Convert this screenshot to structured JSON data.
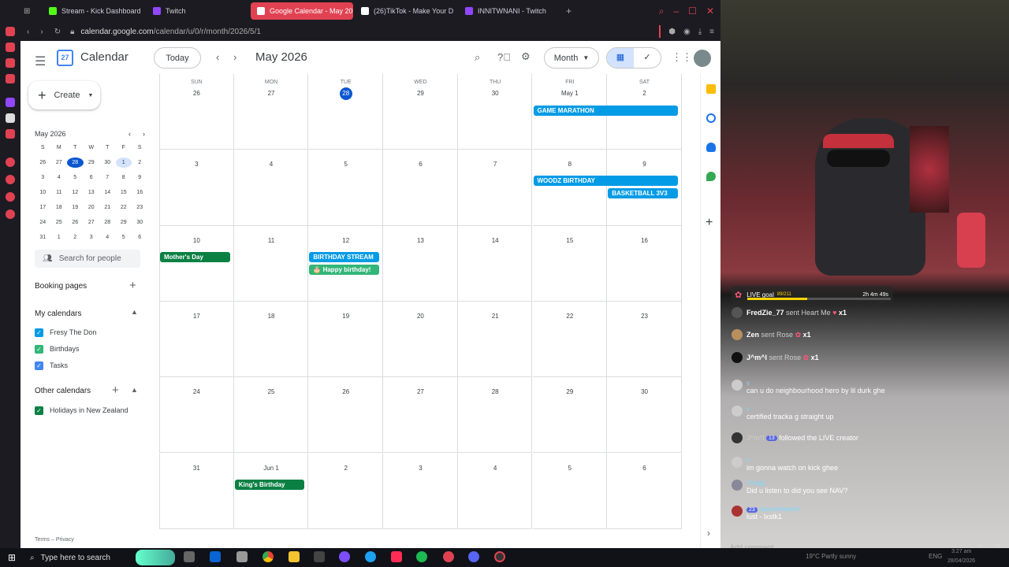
{
  "browser": {
    "tabs": [
      {
        "label": "Stream - Kick Dashboard",
        "color": "#53fc18"
      },
      {
        "label": "Twitch",
        "color": "#9146ff"
      },
      {
        "label": "Google Calendar - May 20",
        "color": "#4285f4"
      },
      {
        "label": "(26)TikTok - Make Your D",
        "color": "#ffffff"
      },
      {
        "label": "INNITWNANI - Twitch",
        "color": "#9146ff"
      }
    ],
    "new_tab": "+",
    "url_domain": "calendar.google.com",
    "url_path": "/calendar/u/0/r/month/2026/5/1"
  },
  "calendar": {
    "app_title": "Calendar",
    "logo_text": "27",
    "today_label": "Today",
    "month_title": "May 2026",
    "view_label": "Month",
    "create_label": "Create",
    "mini": {
      "title": "May 2026",
      "dow": [
        "S",
        "M",
        "T",
        "W",
        "T",
        "F",
        "S"
      ],
      "days": [
        "26",
        "27",
        "28",
        "29",
        "30",
        "1",
        "2",
        "3",
        "4",
        "5",
        "6",
        "7",
        "8",
        "9",
        "10",
        "11",
        "12",
        "13",
        "14",
        "15",
        "16",
        "17",
        "18",
        "19",
        "20",
        "21",
        "22",
        "23",
        "24",
        "25",
        "26",
        "27",
        "28",
        "29",
        "30",
        "31",
        "1",
        "2",
        "3",
        "4",
        "5",
        "6"
      ]
    },
    "search_people": "Search for people",
    "booking_pages": "Booking pages",
    "my_calendars_title": "My calendars",
    "my_calendars": [
      {
        "label": "Fresy The Don",
        "color": "#039be5"
      },
      {
        "label": "Birthdays",
        "color": "#33b679"
      },
      {
        "label": "Tasks",
        "color": "#4285f4"
      }
    ],
    "other_calendars_title": "Other calendars",
    "other_calendars": [
      {
        "label": "Holidays in New Zealand",
        "color": "#0b8043"
      }
    ],
    "footer": "Terms – Privacy",
    "dow": [
      "SUN",
      "MON",
      "TUE",
      "WED",
      "THU",
      "FRI",
      "SAT"
    ],
    "weeks": [
      [
        "26",
        "27",
        "28",
        "29",
        "30",
        "May 1",
        "2"
      ],
      [
        "3",
        "4",
        "5",
        "6",
        "7",
        "8",
        "9"
      ],
      [
        "10",
        "11",
        "12",
        "13",
        "14",
        "15",
        "16"
      ],
      [
        "17",
        "18",
        "19",
        "20",
        "21",
        "22",
        "23"
      ],
      [
        "24",
        "25",
        "26",
        "27",
        "28",
        "29",
        "30"
      ],
      [
        "31",
        "Jun 1",
        "2",
        "3",
        "4",
        "5",
        "6"
      ]
    ],
    "events": {
      "game_marathon": "GAME MARATHON",
      "woodz_birthday": "WOODZ BIRTHDAY",
      "basketball": "BASKETBALL 3V3",
      "mothers_day": "Mother's Day",
      "birthday_stream": "BIRTHDAY STREAM",
      "happy_birthday": "🎂 Happy birthday!",
      "kings_birthday": "King's Birthday"
    },
    "colors": {
      "today": "#0b57d0",
      "event_blue": "#039be5",
      "event_green": "#0b8043",
      "birthday_green": "#33b679"
    }
  },
  "chat": {
    "live_goal": "LIVE goal",
    "goal_count": "89/211",
    "goal_progress": 0.42,
    "timer": "2h 4m 49s",
    "messages": [
      {
        "user": "FredZie_77",
        "text": "sent Heart Me",
        "mult": "x1"
      },
      {
        "user": "Zen",
        "text": "sent Rose",
        "mult": "x1"
      },
      {
        "user": "J^m^l",
        "text": "sent Rose",
        "mult": "x1"
      },
      {
        "user": "v",
        "text": "can u do neighbourhood hero by lil durk ghe"
      },
      {
        "user": "v",
        "text": "certified tracka g straight up"
      },
      {
        "user": "J^m^l",
        "badge": "13",
        "text": "followed the LIVE creator"
      },
      {
        "user": "v",
        "text": "im gonna watch on kick ghee"
      },
      {
        "user": "Yrefgg",
        "text": "Did u listen to did you see NAV?"
      },
      {
        "user": "sigurderbasert",
        "badge": "23",
        "text": "lust - lxstk1"
      }
    ],
    "add_comment": "Add comment"
  },
  "taskbar": {
    "search_placeholder": "Type here to search",
    "weather": "19°C  Partly sunny",
    "lang": "ENG",
    "time": "3:27 am",
    "date": "28/04/2026"
  }
}
